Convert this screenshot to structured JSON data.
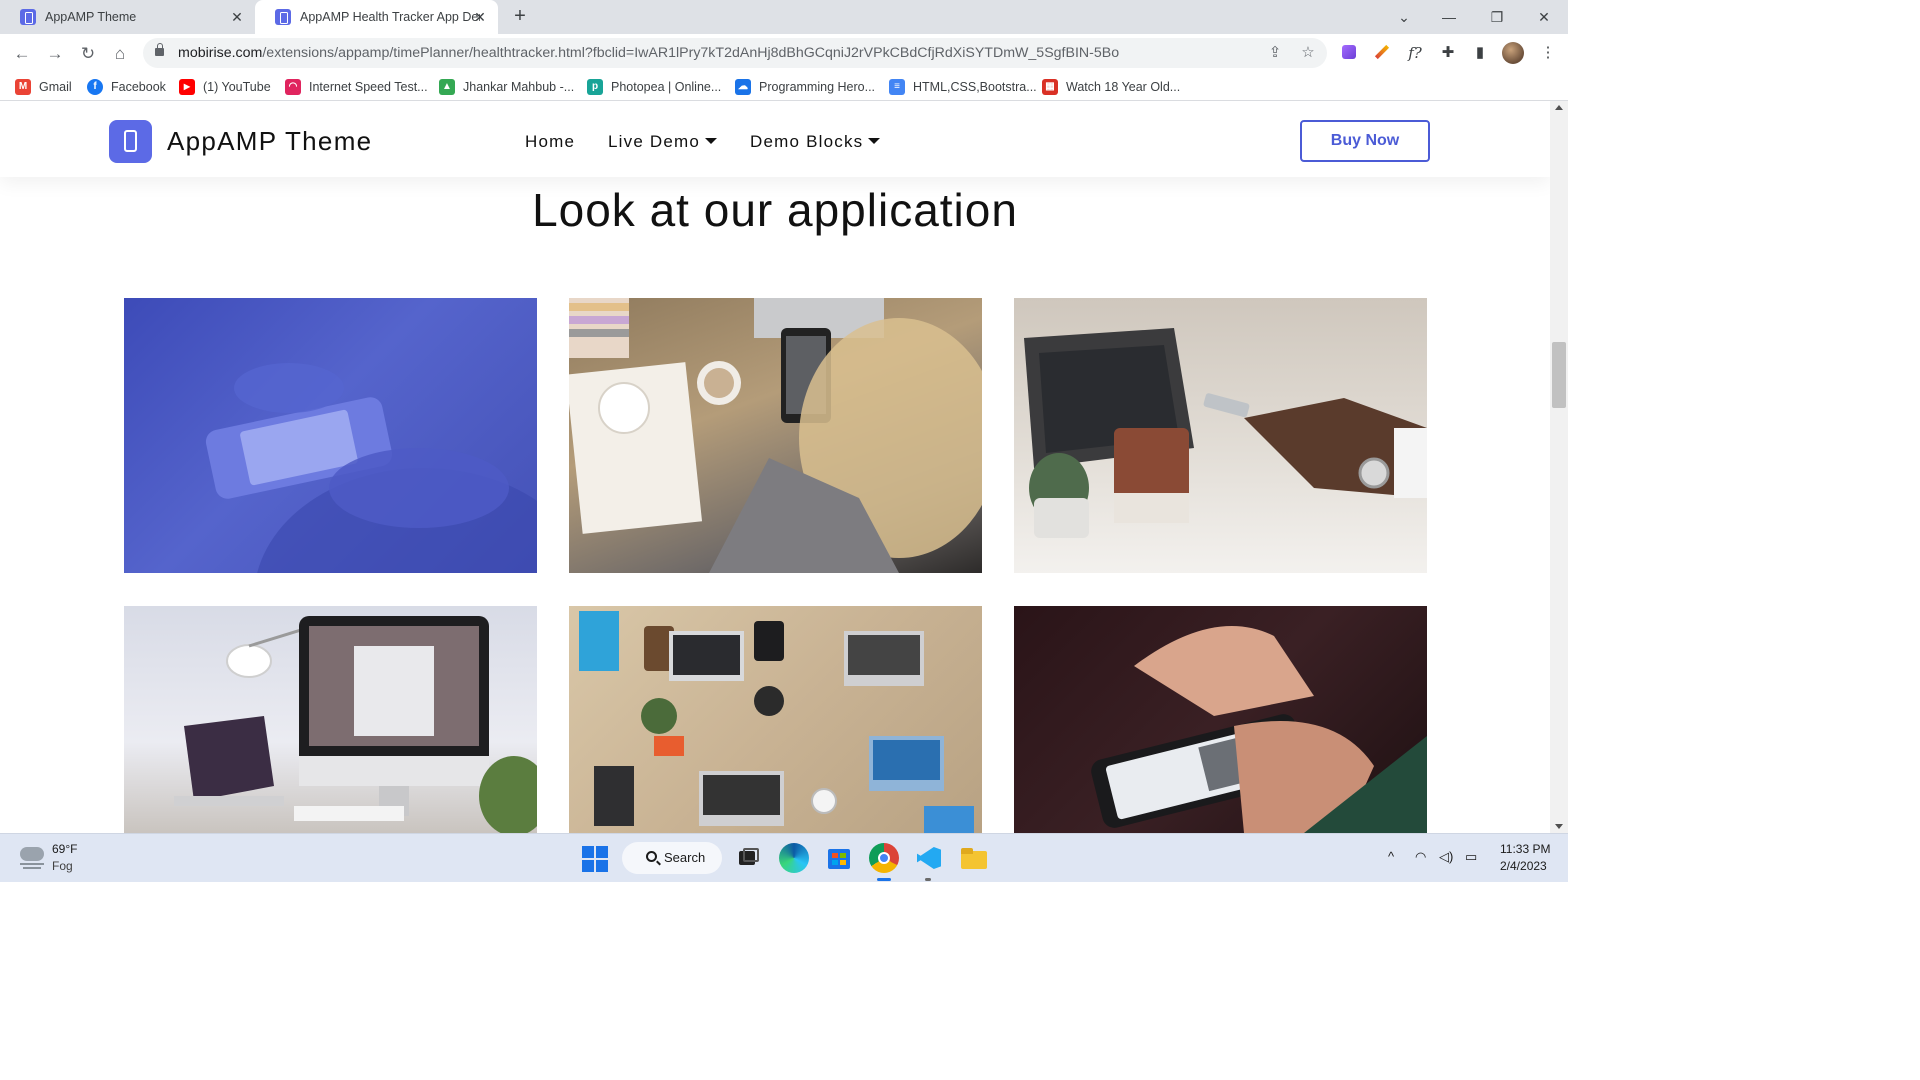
{
  "browser": {
    "tabs": [
      {
        "title": "AppAMP Theme",
        "close": "✕"
      },
      {
        "title": "AppAMP Health Tracker App Dem",
        "close": "✕"
      }
    ],
    "new_tab": "+",
    "window_controls": {
      "minimize": "—",
      "restore": "❐",
      "close": "✕",
      "tab_search": "⌄"
    },
    "nav": {
      "back": "←",
      "forward": "→",
      "reload": "↻",
      "home": "⌂"
    },
    "url": {
      "host": "mobirise.com",
      "path": "/extensions/appamp/timePlanner/healthtracker.html?fbclid=IwAR1lPry7kT2dAnHj8dBhGCqniJ2rVPkCBdCfjRdXiSYTDmW_5SgfBIN-5Bo"
    },
    "omnibox_icons": {
      "share": "⇪",
      "bookmark_star": "☆"
    },
    "extensions": {
      "formula": "f?",
      "puzzle": "✚",
      "sidepanel": "▮"
    },
    "bookmarks": [
      {
        "label": "Gmail",
        "icon": "gmail-icon",
        "color": "#ea4335",
        "glyph": "M"
      },
      {
        "label": "Facebook",
        "icon": "facebook-icon",
        "color": "#1877f2",
        "glyph": "f"
      },
      {
        "label": "(1) YouTube",
        "icon": "youtube-icon",
        "color": "#ff0000",
        "glyph": "▶"
      },
      {
        "label": "Internet Speed Test...",
        "icon": "speedtest-icon",
        "color": "#e0245e",
        "glyph": "◠"
      },
      {
        "label": "Jhankar Mahbub -...",
        "icon": "google-drive-icon",
        "color": "#34a853",
        "glyph": "▲"
      },
      {
        "label": "Photopea | Online...",
        "icon": "photopea-icon",
        "color": "#18a497",
        "glyph": "p"
      },
      {
        "label": "Programming Hero...",
        "icon": "programming-hero-icon",
        "color": "#1a73e8",
        "glyph": "☁"
      },
      {
        "label": "HTML,CSS,Bootstra...",
        "icon": "docs-icon",
        "color": "#4285f4",
        "glyph": "≡"
      },
      {
        "label": "Watch 18 Year Old...",
        "icon": "video-icon",
        "color": "#d93025",
        "glyph": "▦"
      }
    ]
  },
  "site": {
    "brand": "AppAMP Theme",
    "nav": [
      {
        "label": "Home",
        "dropdown": false
      },
      {
        "label": "Live Demo",
        "dropdown": true
      },
      {
        "label": "Demo Blocks",
        "dropdown": true
      }
    ],
    "cta": "Buy Now",
    "accent": "#5c6ae6",
    "section_title": "Look at our application",
    "gallery_photos": [
      "photo-hand-phone-blue",
      "photo-desk-woman-phone",
      "photo-laptop-hand-phone",
      "photo-imac-desk",
      "photo-team-laptops-table",
      "photo-hands-phone-dark"
    ]
  },
  "taskbar": {
    "weather": {
      "temp": "69°F",
      "condition": "Fog"
    },
    "search": "Search",
    "clock": {
      "time": "11:33 PM",
      "date": "2/4/2023"
    },
    "tray": {
      "chevron": "^",
      "wifi": "◠",
      "volume": "◁)",
      "battery": "▭"
    }
  }
}
